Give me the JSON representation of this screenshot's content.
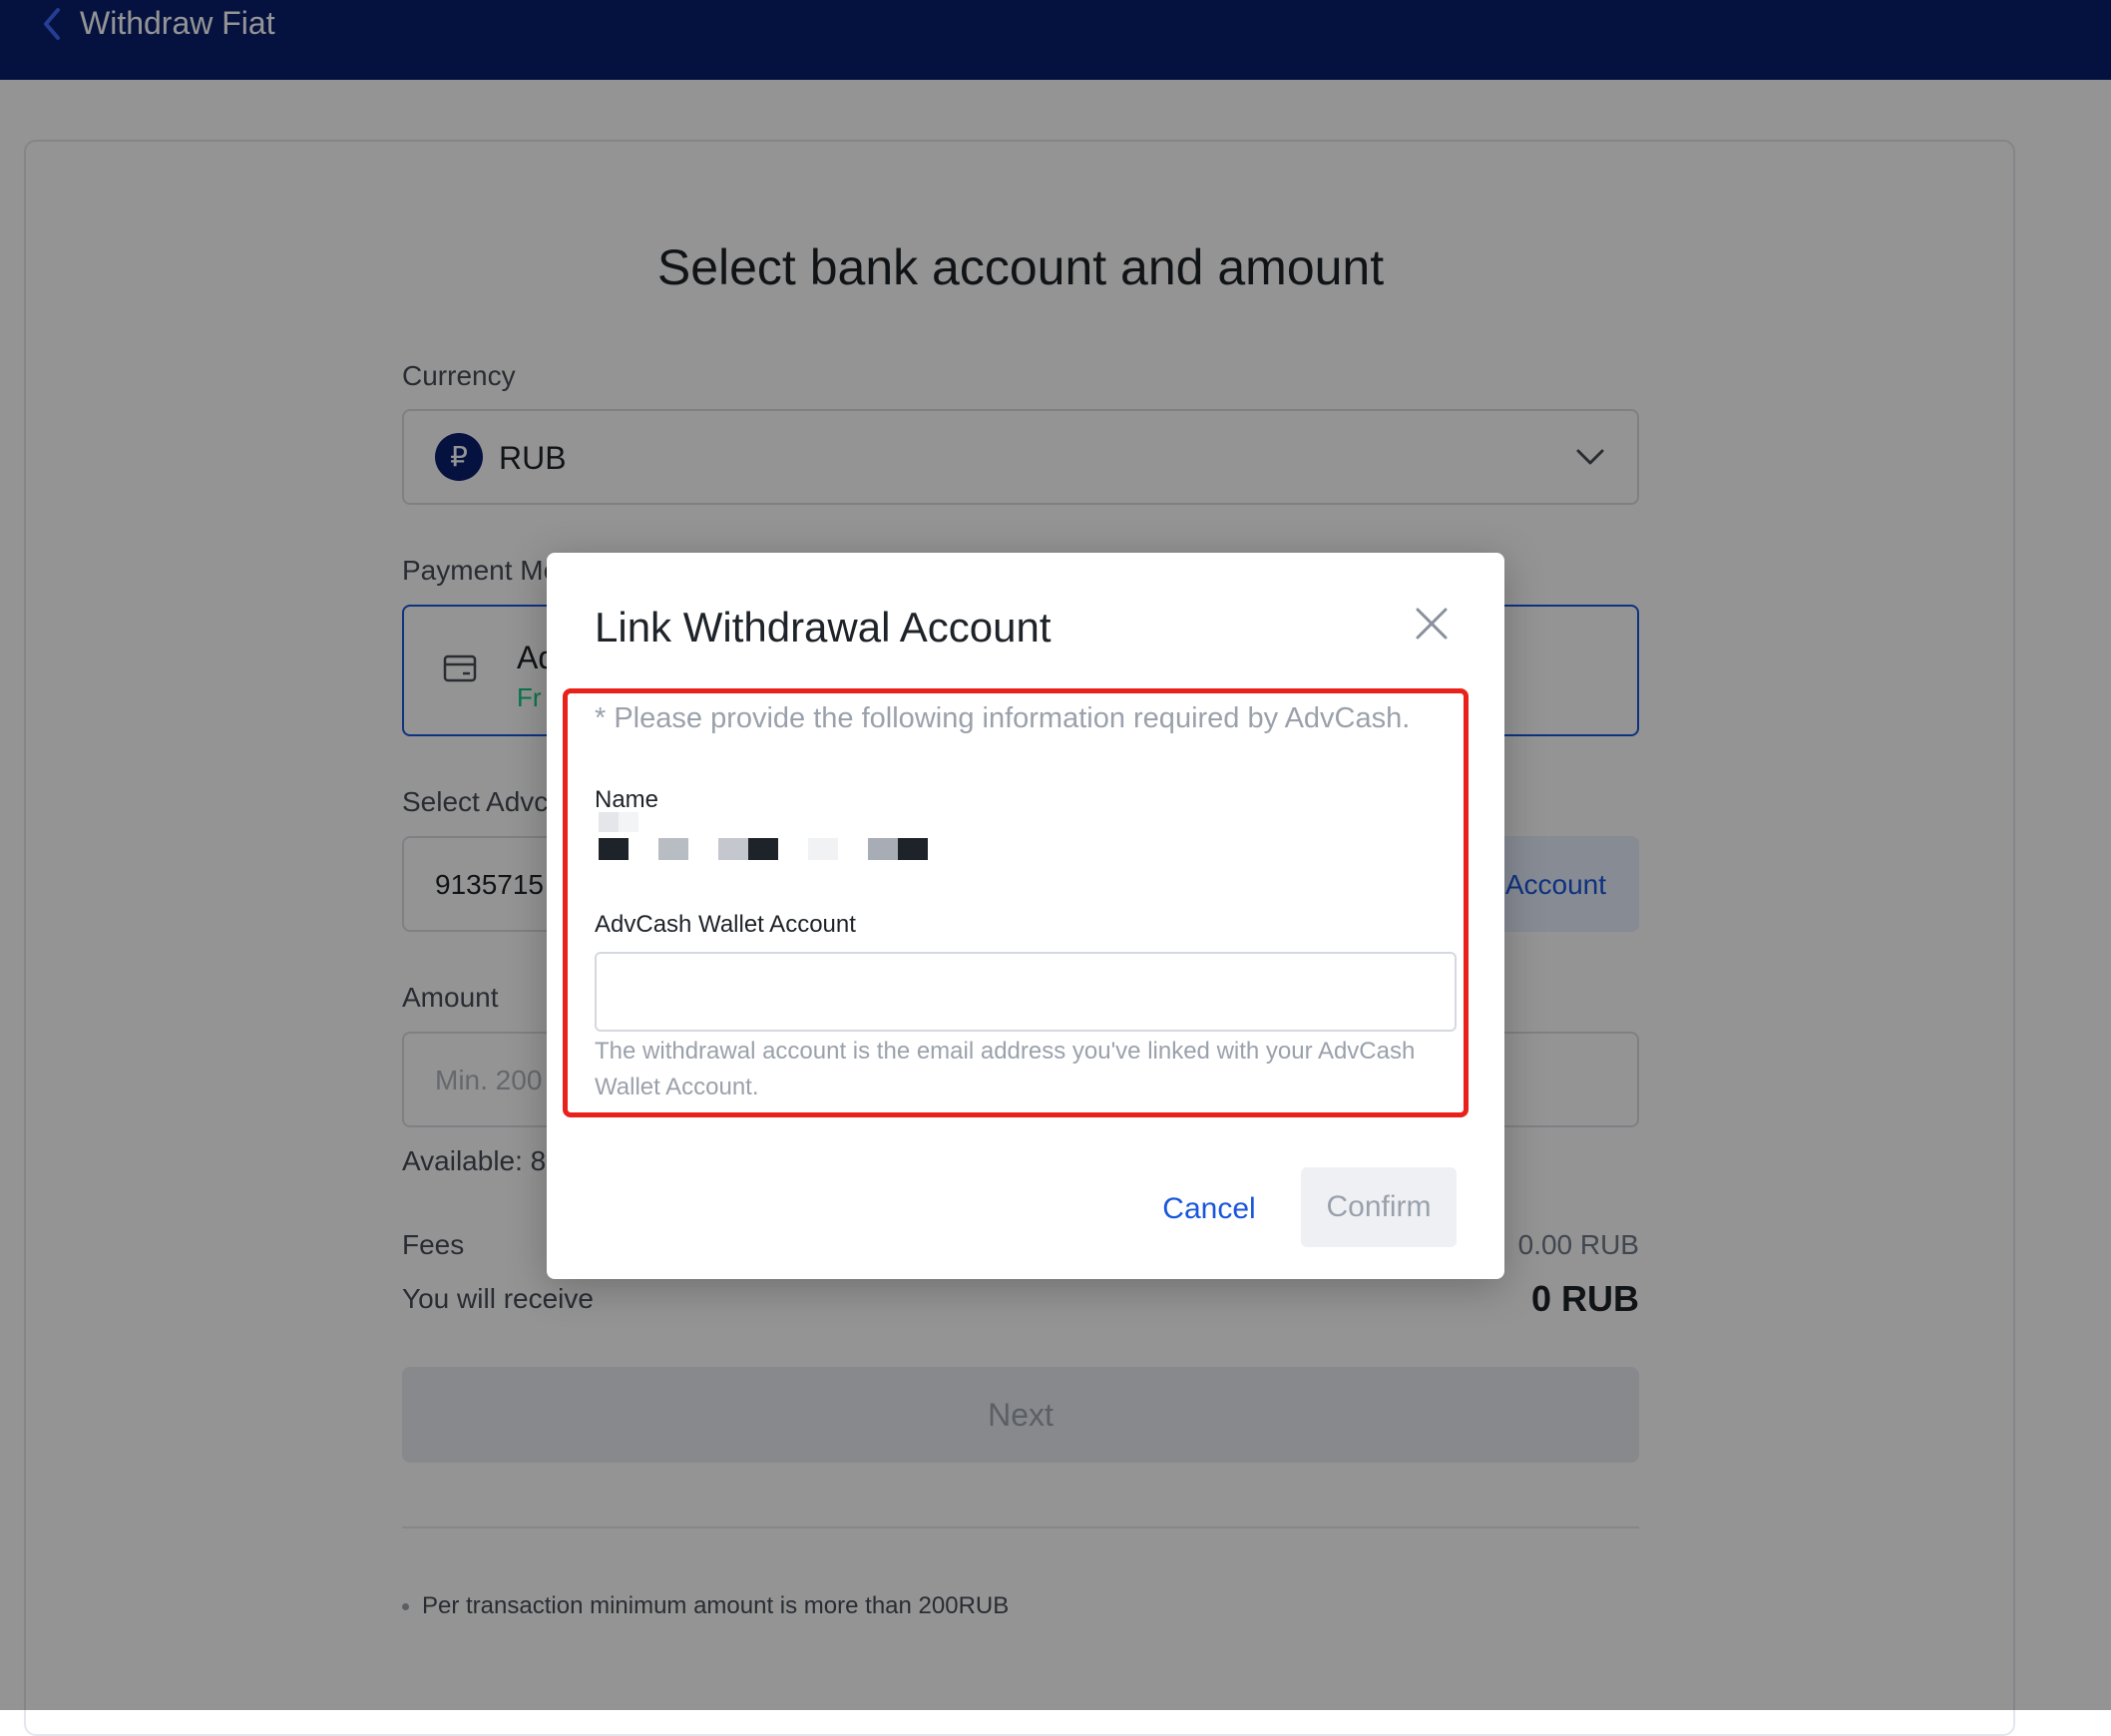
{
  "header": {
    "title": "Withdraw Fiat",
    "back_icon": "chevron-left-icon"
  },
  "form": {
    "title": "Select bank account and amount",
    "currency": {
      "label": "Currency",
      "symbol": "₽",
      "value": "RUB",
      "icon": "chevron-down-icon"
    },
    "payment_method": {
      "label": "Payment Me",
      "name": "Ad",
      "fee": "Fr",
      "icon": "card-icon"
    },
    "account": {
      "label": "Select Advc",
      "value": "9135715",
      "add_label": "Account"
    },
    "amount": {
      "label": "Amount",
      "placeholder": "Min. 200"
    },
    "available": "Available: 8",
    "fees": {
      "label": "Fees",
      "value": "0.00 RUB"
    },
    "receive": {
      "label": "You will receive",
      "value": "0 RUB"
    },
    "next_label": "Next",
    "note": "Per transaction minimum amount is more than 200RUB"
  },
  "modal": {
    "title": "Link Withdrawal Account",
    "required_note": "* Please provide the following information required by AdvCash.",
    "name_label": "Name",
    "wallet_label": "AdvCash Wallet Account",
    "wallet_value": "",
    "hint": "The withdrawal account is the email address you've linked with your AdvCash Wallet Account.",
    "cancel_label": "Cancel",
    "confirm_label": "Confirm"
  },
  "colors": {
    "header_bg": "#0a1f6e",
    "primary": "#1a56db",
    "success": "#0ecb81",
    "highlight": "#e8211a"
  }
}
